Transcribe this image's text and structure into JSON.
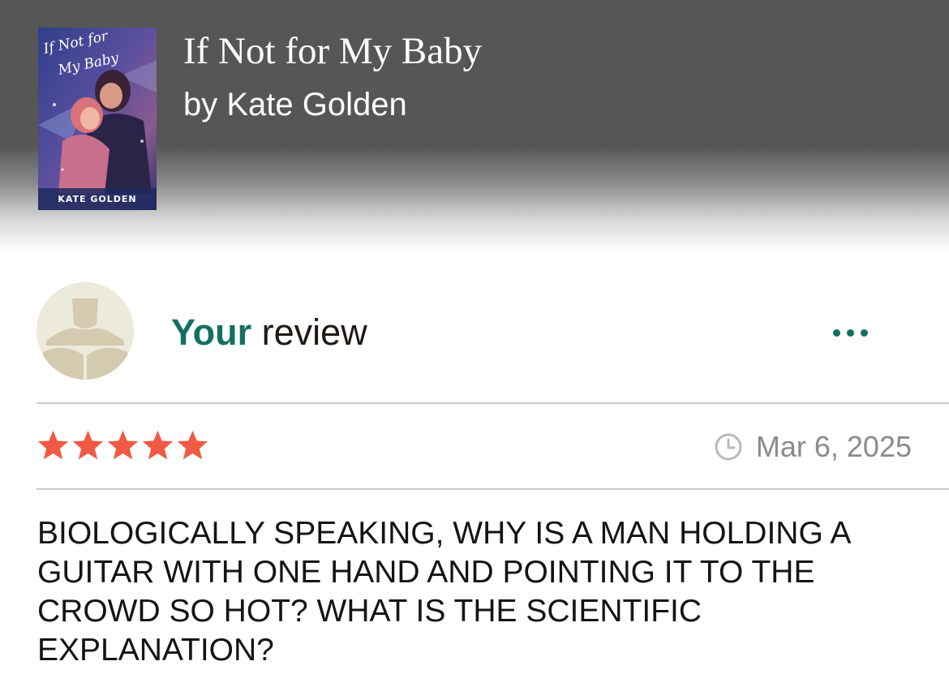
{
  "book": {
    "title": "If Not for My Baby",
    "author_line": "by Kate Golden",
    "cover": {
      "script_title": "If Not for My Baby",
      "author_banner": "KATE GOLDEN"
    }
  },
  "review": {
    "heading_strong": "Your",
    "heading_rest": " review",
    "rating": 5,
    "rating_max": 5,
    "date": "Mar 6, 2025",
    "text": "BIOLOGICALLY SPEAKING, WHY IS A MAN HOLDING A GUITAR WITH ONE HAND AND POINTING IT TO THE CROWD SO HOT? WHAT IS THE SCIENTIFIC EXPLANATION?"
  },
  "icons": {
    "more": "more-options-icon",
    "clock": "clock-icon",
    "star": "star-icon",
    "avatar": "default-reader-avatar"
  },
  "colors": {
    "accent": "#146f62",
    "star": "#f05a45",
    "header_bg": "#565656",
    "muted_text": "#8b8b8b"
  }
}
